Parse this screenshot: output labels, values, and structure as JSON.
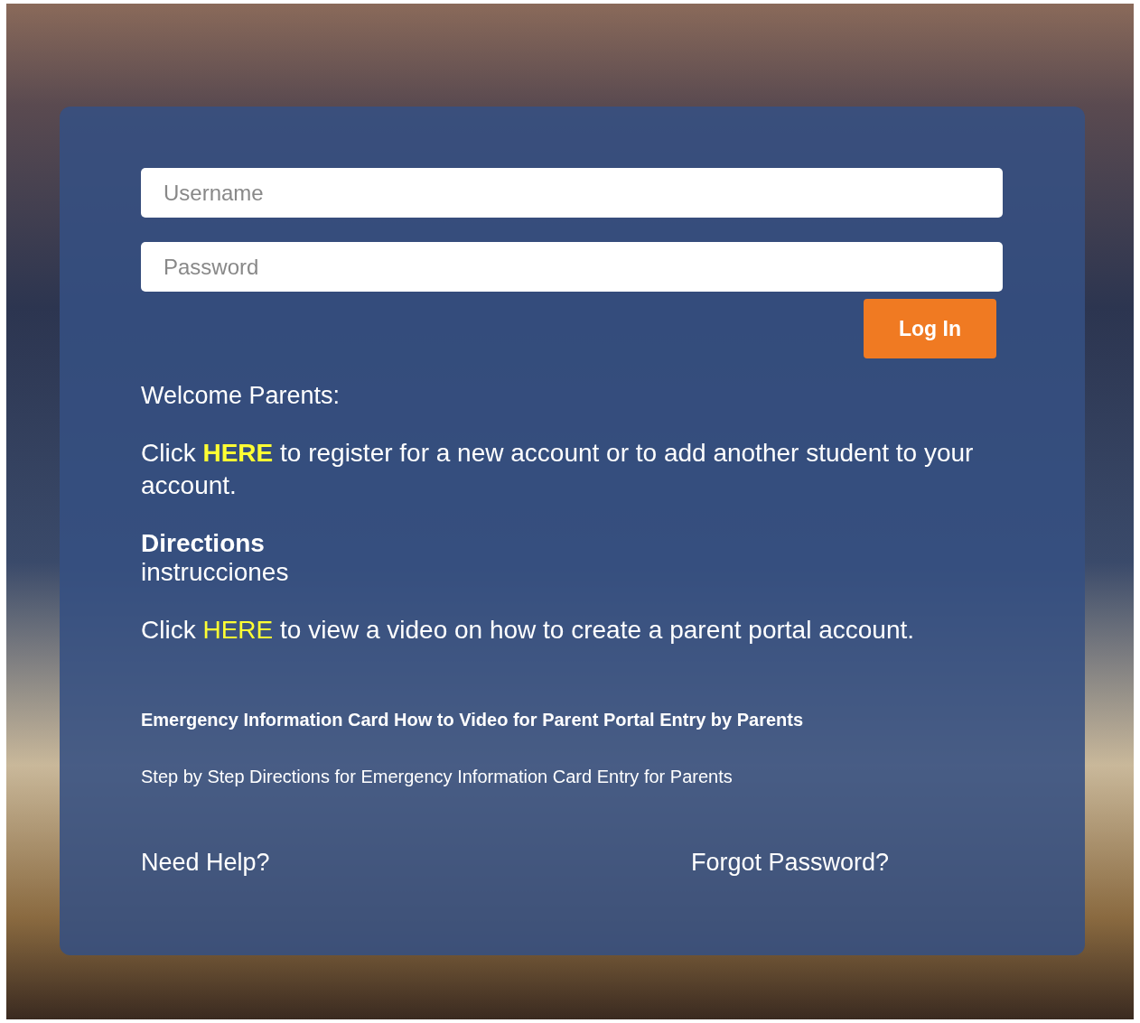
{
  "username": {
    "placeholder": "Username"
  },
  "password": {
    "placeholder": "Password"
  },
  "login_button": "Log In",
  "welcome": "Welcome Parents:",
  "register": {
    "before": "Click ",
    "link": "HERE",
    "after": " to register for a new account or to add another student to your account."
  },
  "directions": {
    "title": "Directions",
    "subtitle": "instrucciones"
  },
  "video": {
    "before": "Click ",
    "link": "HERE",
    "after": " to view a video on how to create a parent portal account."
  },
  "links": [
    {
      "kind": "bold",
      "text": "Emergency Information Card How to Video for Parent Portal Entry by Parents"
    },
    {
      "kind": "plain",
      "text": "Step by Step Directions for Emergency Information Card Entry for Parents"
    }
  ],
  "footer": {
    "help": "Need Help?",
    "forgot": "Forgot Password?"
  }
}
